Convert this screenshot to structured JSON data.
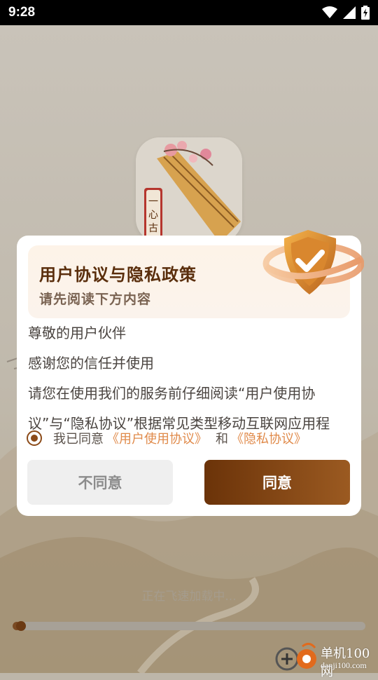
{
  "status_bar": {
    "time": "9:28",
    "icons": [
      "wifi-icon",
      "signal-icon",
      "battery-charging-icon"
    ]
  },
  "splash": {
    "app_icon_text": "一心古筝",
    "loading_text": "正在飞速加载中...",
    "progress": 0.01
  },
  "dialog": {
    "title": "用户协议与隐私政策",
    "subtitle": "请先阅读下方内容",
    "body": [
      "尊敬的用户伙伴",
      "感谢您的信任并使用",
      "请您在使用我们的服务前仔细阅读“用户使用协",
      "议”与“隐私协议”根据常见类型移动互联网应用程"
    ],
    "consent": {
      "prefix": "我已同意",
      "user_agreement": "《用户使用协议》",
      "and": "和",
      "privacy_agreement": "《隐私协议》",
      "checked": true
    },
    "buttons": {
      "disagree": "不同意",
      "agree": "同意"
    }
  },
  "watermark": {
    "name": "单机100网",
    "url": "danji100.com"
  },
  "colors": {
    "accent_brown": "#6b3309",
    "link_orange": "#e08a4a",
    "title_brown": "#5a2e0c"
  }
}
